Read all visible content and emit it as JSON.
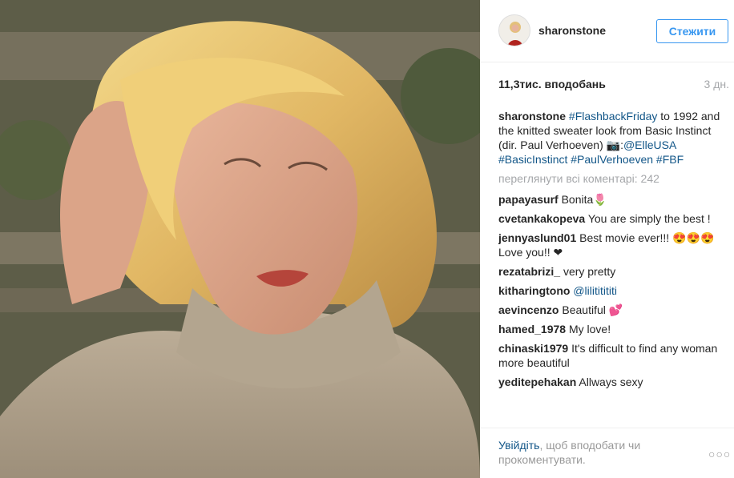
{
  "post": {
    "username": "sharonstone",
    "follow_label": "Стежити",
    "likes": "11,3тис. вподобань",
    "time": "3 дн.",
    "caption": {
      "user": "sharonstone",
      "text_parts": [
        {
          "tag": true,
          "text": "#FlashbackFriday"
        },
        {
          "tag": false,
          "text": " to 1992 and the knitted sweater look from Basic Instinct (dir. Paul Verhoeven) 📷:"
        },
        {
          "tag": true,
          "text": "@ElleUSA"
        },
        {
          "tag": false,
          "text": " "
        },
        {
          "tag": true,
          "text": "#BasicInstinct"
        },
        {
          "tag": false,
          "text": " "
        },
        {
          "tag": true,
          "text": "#PaulVerhoeven"
        },
        {
          "tag": false,
          "text": " "
        },
        {
          "tag": true,
          "text": "#FBF"
        }
      ]
    },
    "view_all": "переглянути всі коментарі: 242",
    "comments": [
      {
        "user": "papayasurf",
        "text": "Bonita🌷",
        "mention": false
      },
      {
        "user": "cvetankakopeva",
        "text": "You are simply the best !",
        "mention": false
      },
      {
        "user": "jennyaslund01",
        "text": "Best movie ever!!! 😍😍😍 Love you!! ❤",
        "mention": false
      },
      {
        "user": "rezatabrizi_",
        "text": "very pretty",
        "mention": false
      },
      {
        "user": "kitharingtono",
        "text": "@lilititititi",
        "mention": true
      },
      {
        "user": "aevincenzo",
        "text": "Beautiful 💕",
        "mention": false
      },
      {
        "user": "hamed_1978",
        "text": "My love!",
        "mention": false
      },
      {
        "user": "chinaski1979",
        "text": "It's difficult to find any woman more beautiful",
        "mention": false
      },
      {
        "user": "yeditepehakan",
        "text": "Allways sexy",
        "mention": false
      }
    ],
    "footer": {
      "link": "Увійдіть",
      "rest": ", щоб вподобати чи прокоментувати.",
      "more_icon": "more-dots-icon"
    }
  },
  "colors": {
    "accent": "#3897f0",
    "link": "#125688",
    "muted": "#a5a7aa"
  }
}
